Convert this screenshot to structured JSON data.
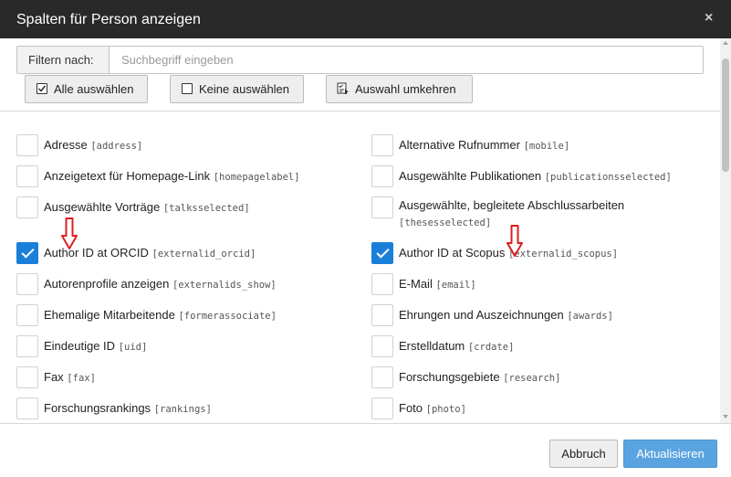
{
  "dialog": {
    "title": "Spalten für Person anzeigen",
    "close_symbol": "×"
  },
  "filter": {
    "label": "Filtern nach:",
    "placeholder": "Suchbegriff eingeben",
    "value": ""
  },
  "toolbar": {
    "select_all": "Alle auswählen",
    "select_none": "Keine auswählen",
    "invert": "Auswahl umkehren"
  },
  "columns": [
    {
      "label": "Adresse",
      "key": "[address]",
      "checked": false
    },
    {
      "label": "Alternative Rufnummer",
      "key": "[mobile]",
      "checked": false
    },
    {
      "label": "Anzeigetext für Homepage-Link",
      "key": "[homepagelabel]",
      "checked": false
    },
    {
      "label": "Ausgewählte Publikationen",
      "key": "[publicationsselected]",
      "checked": false
    },
    {
      "label": "Ausgewählte Vorträge",
      "key": "[talksselected]",
      "checked": false
    },
    {
      "label": "Ausgewählte, begleitete Abschlussarbeiten",
      "key": "[thesesselected]",
      "checked": false
    },
    {
      "label": "Author ID at ORCID",
      "key": "[externalid_orcid]",
      "checked": true
    },
    {
      "label": "Author ID at Scopus",
      "key": "[externalid_scopus]",
      "checked": true
    },
    {
      "label": "Autorenprofile anzeigen",
      "key": "[externalids_show]",
      "checked": false
    },
    {
      "label": "E-Mail",
      "key": "[email]",
      "checked": false
    },
    {
      "label": "Ehemalige Mitarbeitende",
      "key": "[formerassociate]",
      "checked": false
    },
    {
      "label": "Ehrungen und Auszeichnungen",
      "key": "[awards]",
      "checked": false
    },
    {
      "label": "Eindeutige ID",
      "key": "[uid]",
      "checked": false
    },
    {
      "label": "Erstelldatum",
      "key": "[crdate]",
      "checked": false
    },
    {
      "label": "Fax",
      "key": "[fax]",
      "checked": false
    },
    {
      "label": "Forschungsgebiete",
      "key": "[research]",
      "checked": false
    },
    {
      "label": "Forschungsrankings",
      "key": "[rankings]",
      "checked": false
    },
    {
      "label": "Foto",
      "key": "[photo]",
      "checked": false
    }
  ],
  "footer": {
    "cancel": "Abbruch",
    "update": "Aktualisieren"
  },
  "colors": {
    "header_bg": "#292929",
    "checkbox_checked": "#1a7fd8",
    "primary_button": "#59a4e0",
    "annotation_arrow": "#d9211f"
  },
  "icons": {
    "select_all": "checked-box-icon",
    "select_none": "empty-box-icon",
    "invert": "invert-selection-icon",
    "annotation": "down-arrow-icon"
  }
}
